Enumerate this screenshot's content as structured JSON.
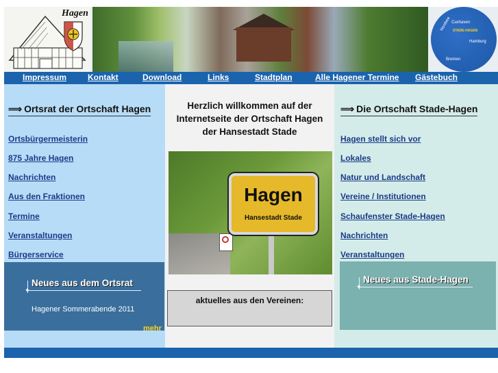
{
  "header": {
    "crest_title": "Hagen",
    "map": {
      "label_1": "Nordsee",
      "label_2": "Cuxhaven",
      "label_3": "STADE-HAGEN",
      "label_4": "Hamburg",
      "label_5": "Bremen"
    }
  },
  "nav": {
    "items": [
      "Impressum",
      "Kontakt",
      "Download",
      "Links",
      "Stadtplan",
      "Alle Hagener Termine",
      "Gästebuch"
    ]
  },
  "left": {
    "title": "Ortsrat der Ortschaft Hagen",
    "links": [
      "Ortsbürgermeisterin",
      "875 Jahre Hagen",
      "Nachrichten",
      "Aus den Fraktionen",
      "Termine",
      "Veranstaltungen",
      "Bürgerservice"
    ],
    "news_title": "Neues aus dem Ortsrat",
    "news_item": "Hagener Sommerabende 2011",
    "more": "mehr"
  },
  "middle": {
    "welcome_line1": "Herzlich willkommen auf der",
    "welcome_line2": "Internetseite der Ortschaft Hagen",
    "welcome_line3": "der Hansestadt Stade",
    "sign_title": "Hagen",
    "sign_subtitle": "Hansestadt Stade",
    "vereine_title": "aktuelles aus den Vereinen:"
  },
  "right": {
    "title": "Die Ortschaft Stade-Hagen",
    "links": [
      "Hagen stellt sich vor",
      "Lokales",
      "Natur und Landschaft",
      "Vereine / Institutionen",
      "Schaufenster Stade-Hagen",
      "Nachrichten",
      "Veranstaltungen"
    ],
    "news_title": "Neues aus Stade-Hagen"
  },
  "colors": {
    "nav_blue": "#1b63ad",
    "left_bg": "#b7dcf7",
    "right_bg": "#d4ece9",
    "mid_bg": "#f2f2f2"
  }
}
